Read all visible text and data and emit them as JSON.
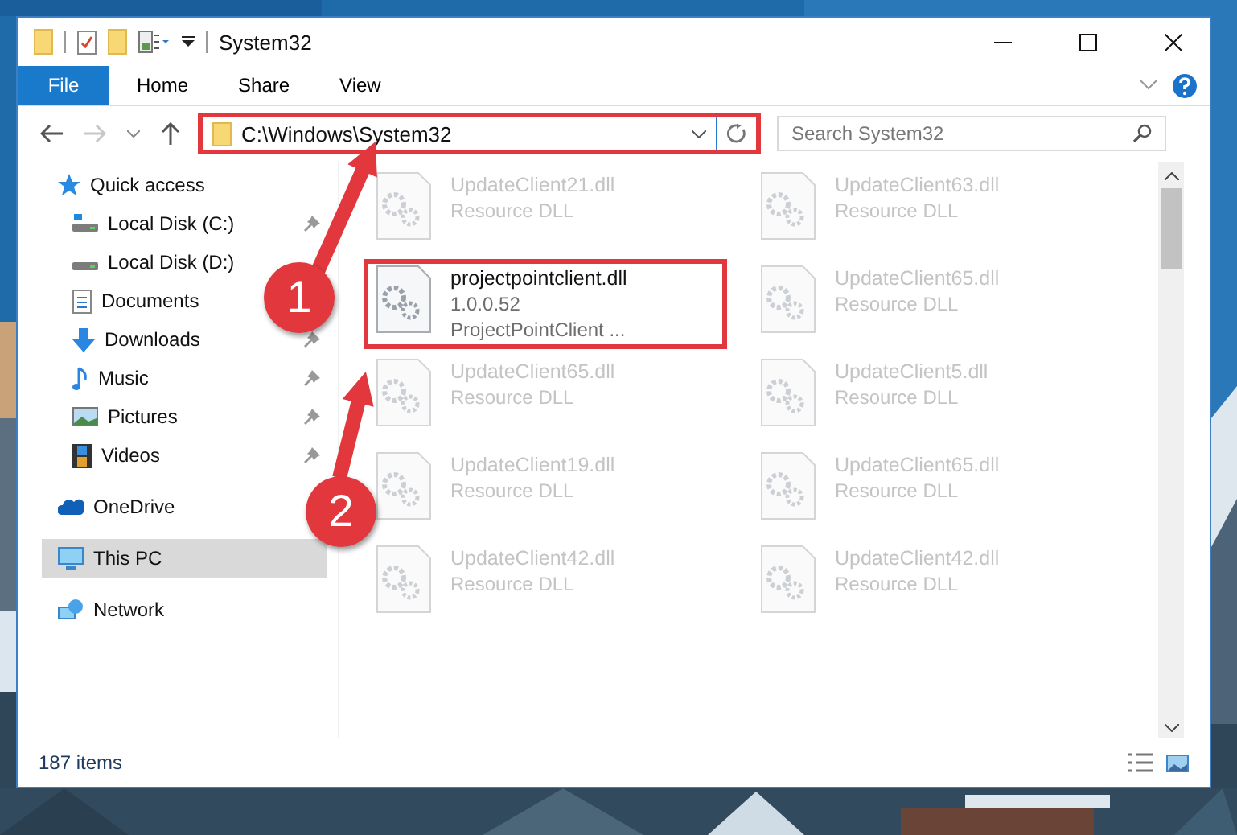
{
  "window": {
    "title": "System32"
  },
  "ribbon": {
    "tabs": [
      {
        "label": "File",
        "kind": "file",
        "selected": false
      },
      {
        "label": "Home",
        "kind": "tab",
        "selected": false
      },
      {
        "label": "Share",
        "kind": "tab",
        "selected": false
      },
      {
        "label": "View",
        "kind": "tab",
        "selected": false
      }
    ]
  },
  "address_bar": {
    "path": "C:\\Windows\\System32",
    "highlighted": true
  },
  "search": {
    "placeholder": "Search System32"
  },
  "sidebar": {
    "items": [
      {
        "label": "Quick access",
        "selected": false,
        "children": [
          {
            "label": "Local Disk (C:)",
            "pinned": true,
            "selected": false
          },
          {
            "label": "Local Disk (D:)",
            "pinned": false,
            "selected": false
          },
          {
            "label": "Documents",
            "pinned": false,
            "selected": false
          },
          {
            "label": "Downloads",
            "pinned": true,
            "selected": false
          },
          {
            "label": "Music",
            "pinned": true,
            "selected": false
          },
          {
            "label": "Pictures",
            "pinned": true,
            "selected": false
          },
          {
            "label": "Videos",
            "pinned": true,
            "selected": false
          }
        ]
      },
      {
        "label": "OneDrive",
        "selected": false
      },
      {
        "label": "This PC",
        "selected": true
      },
      {
        "label": "Network",
        "selected": false
      }
    ]
  },
  "files": [
    {
      "name": "UpdateClient21.dll",
      "details": [
        "Resource DLL"
      ],
      "blurred": true,
      "highlighted": false
    },
    {
      "name": "UpdateClient63.dll",
      "details": [
        "Resource DLL"
      ],
      "blurred": true,
      "highlighted": false
    },
    {
      "name": "projectpointclient.dll",
      "details": [
        "1.0.0.52",
        "ProjectPointClient ..."
      ],
      "blurred": false,
      "highlighted": true
    },
    {
      "name": "UpdateClient65.dll",
      "details": [
        "Resource DLL"
      ],
      "blurred": true,
      "highlighted": false
    },
    {
      "name": "UpdateClient65.dll",
      "details": [
        "Resource DLL"
      ],
      "blurred": true,
      "highlighted": false
    },
    {
      "name": "UpdateClient5.dll",
      "details": [
        "Resource DLL"
      ],
      "blurred": true,
      "highlighted": false
    },
    {
      "name": "UpdateClient19.dll",
      "details": [
        "Resource DLL"
      ],
      "blurred": true,
      "highlighted": false
    },
    {
      "name": "UpdateClient65.dll",
      "details": [
        "Resource DLL"
      ],
      "blurred": true,
      "highlighted": false
    },
    {
      "name": "UpdateClient42.dll",
      "details": [
        "Resource DLL"
      ],
      "blurred": true,
      "highlighted": false
    },
    {
      "name": "UpdateClient42.dll",
      "details": [
        "Resource DLL"
      ],
      "blurred": true,
      "highlighted": false
    }
  ],
  "annotations": [
    {
      "number": "1"
    },
    {
      "number": "2"
    }
  ],
  "status_bar": {
    "item_count": "187 items"
  }
}
